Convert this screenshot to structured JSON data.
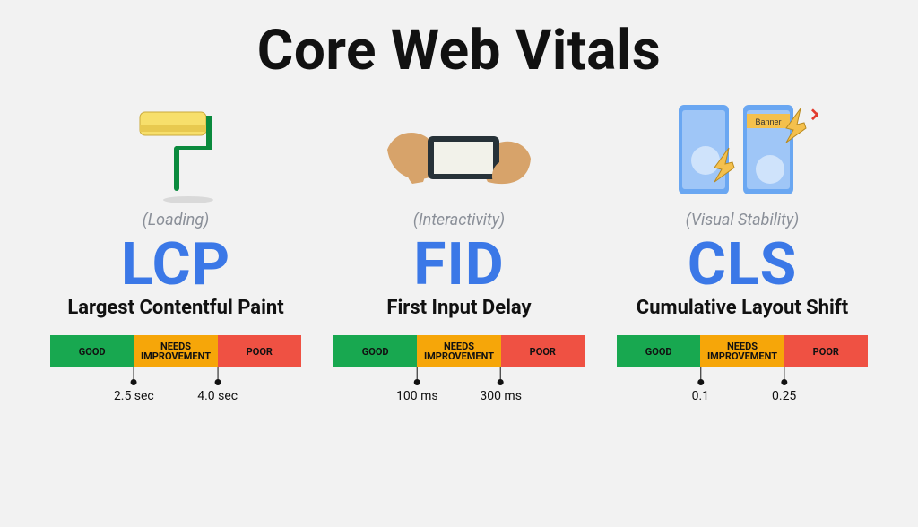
{
  "title": "Core Web Vitals",
  "scale": {
    "good": "GOOD",
    "mid": "NEEDS\nIMPROVEMENT",
    "poor": "POOR"
  },
  "metrics": {
    "lcp": {
      "category": "(Loading)",
      "acronym": "LCP",
      "fullname": "Largest Contentful Paint",
      "threshold_a": "2.5 sec",
      "threshold_b": "4.0 sec"
    },
    "fid": {
      "category": "(Interactivity)",
      "acronym": "FID",
      "fullname": "First Input Delay",
      "threshold_a": "100 ms",
      "threshold_b": "300 ms"
    },
    "cls": {
      "category": "(Visual Stability)",
      "acronym": "CLS",
      "fullname": "Cumulative Layout Shift",
      "threshold_a": "0.1",
      "threshold_b": "0.25"
    }
  },
  "colors": {
    "accent": "#3b78e7",
    "good": "#18a850",
    "mid": "#f6a609",
    "poor": "#ef5143"
  }
}
